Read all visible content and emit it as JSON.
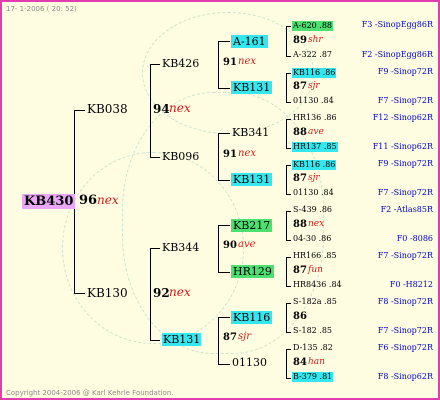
{
  "date": "17-  1-2006 ( 20: 52)",
  "copyright": "Copyright 2004-2006 @ Karl Kehrle Foundation.",
  "subject": {
    "id": "KB430",
    "score": "96",
    "tag": "nex"
  },
  "gen2": [
    {
      "id": "KB038",
      "score": "94",
      "tag": "nex"
    },
    {
      "id": "KB130",
      "score": "92",
      "tag": "nex"
    }
  ],
  "gen3": [
    {
      "id": "KB426",
      "score": "91",
      "tag": "nex"
    },
    {
      "id": "KB096",
      "score": "91",
      "tag": "nex"
    },
    {
      "id": "KB344",
      "score": "90",
      "tag": "ave"
    },
    {
      "id": "KB131",
      "score": "87",
      "tag": "sjr"
    }
  ],
  "gen4": [
    {
      "id": "A-161"
    },
    {
      "id": "KB131"
    },
    {
      "id": "KB341"
    },
    {
      "id": "KB131"
    },
    {
      "id": "KB217"
    },
    {
      "id": "HR129"
    },
    {
      "id": "KB116"
    },
    {
      "id": "01130"
    }
  ],
  "gen5": [
    {
      "sire": "A-620 .88",
      "sire_loft": "F3 -SinopEgg86R",
      "score": "89",
      "tag": "shr",
      "dam": "A-322 .87",
      "dam_loft": "F2 -SinopEgg86R"
    },
    {
      "sire": "KB116 .86",
      "sire_loft": "F9 -Sinop72R",
      "score": "87",
      "tag": "sjr",
      "dam": "01130 .84",
      "dam_loft": "F7 -Sinop72R"
    },
    {
      "sire": "HR136 .86",
      "sire_loft": "F12 -Sinop62R",
      "score": "88",
      "tag": "ave",
      "dam": "HR137 .85",
      "dam_loft": "F11 -Sinop62R"
    },
    {
      "sire": "KB116 .86",
      "sire_loft": "F9 -Sinop72R",
      "score": "87",
      "tag": "sjr",
      "dam": "01130 .84",
      "dam_loft": "F7 -Sinop72R"
    },
    {
      "sire": "S-439 .86",
      "sire_loft": "F2 -Atlas85R",
      "score": "88",
      "tag": "nex",
      "dam": "04-30 .86",
      "dam_loft": "F0 -8086"
    },
    {
      "sire": "HR166 .85",
      "sire_loft": "F7 -Sinop72R",
      "score": "87",
      "tag": "fun",
      "dam": "HR8436 .84",
      "dam_loft": "F0 -H8212"
    },
    {
      "sire": "S-182a .85",
      "sire_loft": "F8 -Sinop72R",
      "score": "86",
      "tag": "",
      "dam": "S-182 .85",
      "dam_loft": "F7 -Sinop72R"
    },
    {
      "sire": "D-135 .82",
      "sire_loft": "F6 -Sinop72R",
      "score": "84",
      "tag": "han",
      "dam": "B-379 .81",
      "dam_loft": "F8 -Sinop62R"
    }
  ]
}
